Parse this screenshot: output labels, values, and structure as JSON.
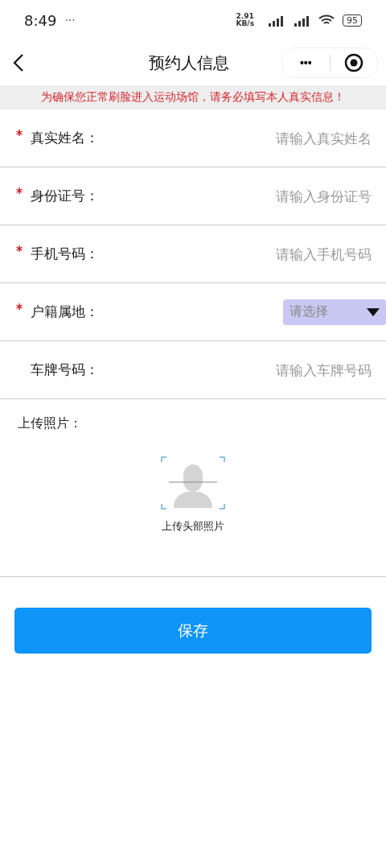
{
  "status_bar": {
    "time": "8:49",
    "more": "···",
    "speed": "2.91",
    "speed_unit": "KB/s",
    "battery": "95"
  },
  "header": {
    "title": "预约人信息",
    "more": "•••"
  },
  "notice": "为确保您正常刷脸进入运动场馆，请务必填写本人真实信息！",
  "fields": [
    {
      "kind": "input",
      "label": "真实姓名：",
      "required": true,
      "placeholder": "请输入真实姓名"
    },
    {
      "kind": "input",
      "label": "身份证号：",
      "required": true,
      "placeholder": "请输入身份证号"
    },
    {
      "kind": "input",
      "label": "手机号码：",
      "required": true,
      "placeholder": "请输入手机号码"
    },
    {
      "kind": "select",
      "label": "户籍属地：",
      "required": true,
      "placeholder": "请选择"
    },
    {
      "kind": "input",
      "label": "车牌号码：",
      "required": false,
      "placeholder": "请输入车牌号码"
    }
  ],
  "photo": {
    "label": "上传照片：",
    "caption": "上传头部照片"
  },
  "save_button": "保存"
}
